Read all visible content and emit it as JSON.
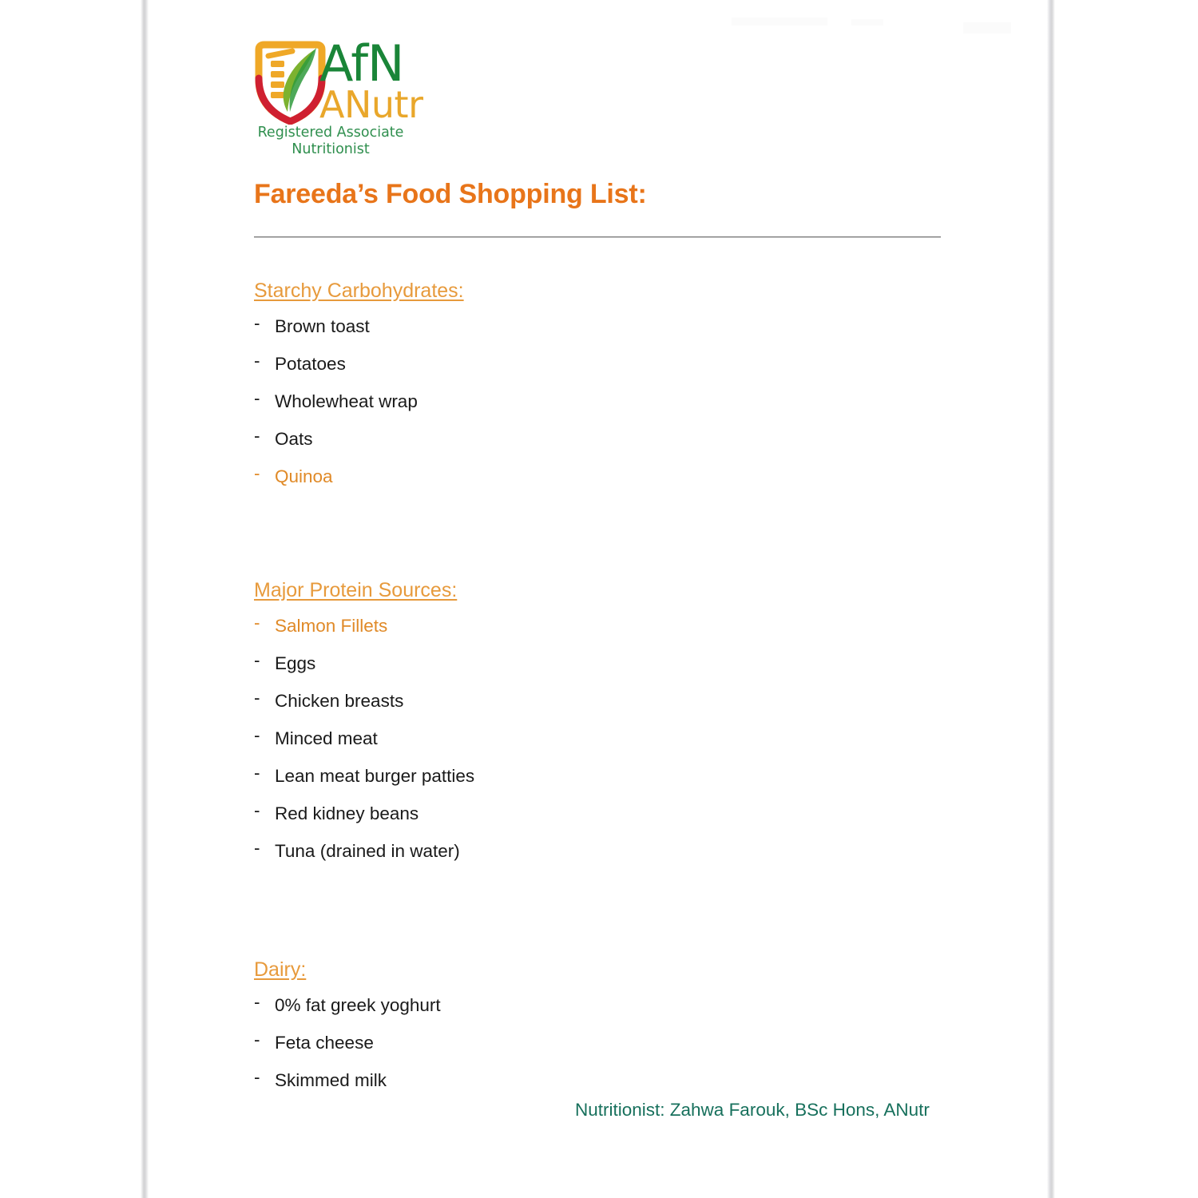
{
  "logo": {
    "name": "afn-anutr-logo",
    "wordmark_primary": "AfN",
    "wordmark_secondary": "ANutr",
    "strapline": "Registered Associate\nNutritionist",
    "strapline_line1": "Registered Associate",
    "strapline_line2": "Nutritionist",
    "colors": {
      "green": "#1a8538",
      "amber": "#e9a72b",
      "strapline_green": "#2f8f4e",
      "shield_orange": "#efa827",
      "shield_red": "#cf2030",
      "shield_leaf_green": "#7cb22f",
      "shield_leaf_dark": "#2f9a3c"
    }
  },
  "document": {
    "title": "Fareeda’s Food Shopping List:",
    "title_color": "#e8751a",
    "rule_color": "#7d7d7d",
    "heading_color": "#e79a3c",
    "item_color": "#1a1a1a",
    "accent_item_color": "#e08a28",
    "footer_color": "#17705c"
  },
  "sections": [
    {
      "heading": "Starchy Carbohydrates:",
      "bullet": "-",
      "items": [
        {
          "label": "Brown toast",
          "accent": false
        },
        {
          "label": "Potatoes",
          "accent": false
        },
        {
          "label": "Wholewheat wrap",
          "accent": false
        },
        {
          "label": "Oats",
          "accent": false
        },
        {
          "label": "Quinoa",
          "accent": true
        }
      ]
    },
    {
      "heading": "Major Protein Sources:",
      "bullet": "-",
      "items": [
        {
          "label": "Salmon Fillets",
          "accent": true
        },
        {
          "label": "Eggs",
          "accent": false
        },
        {
          "label": "Chicken breasts",
          "accent": false
        },
        {
          "label": "Minced meat",
          "accent": false
        },
        {
          "label": "Lean meat burger patties",
          "accent": false
        },
        {
          "label": "Red kidney beans",
          "accent": false
        },
        {
          "label": "Tuna (drained in water)",
          "accent": false
        }
      ]
    },
    {
      "heading": "Dairy:",
      "bullet": "-",
      "items": [
        {
          "label": "0% fat greek yoghurt",
          "accent": false
        },
        {
          "label": "Feta cheese",
          "accent": false
        },
        {
          "label": "Skimmed milk",
          "accent": false
        }
      ]
    }
  ],
  "footer": {
    "credit": "Nutritionist: Zahwa Farouk, BSc Hons, ANutr"
  }
}
